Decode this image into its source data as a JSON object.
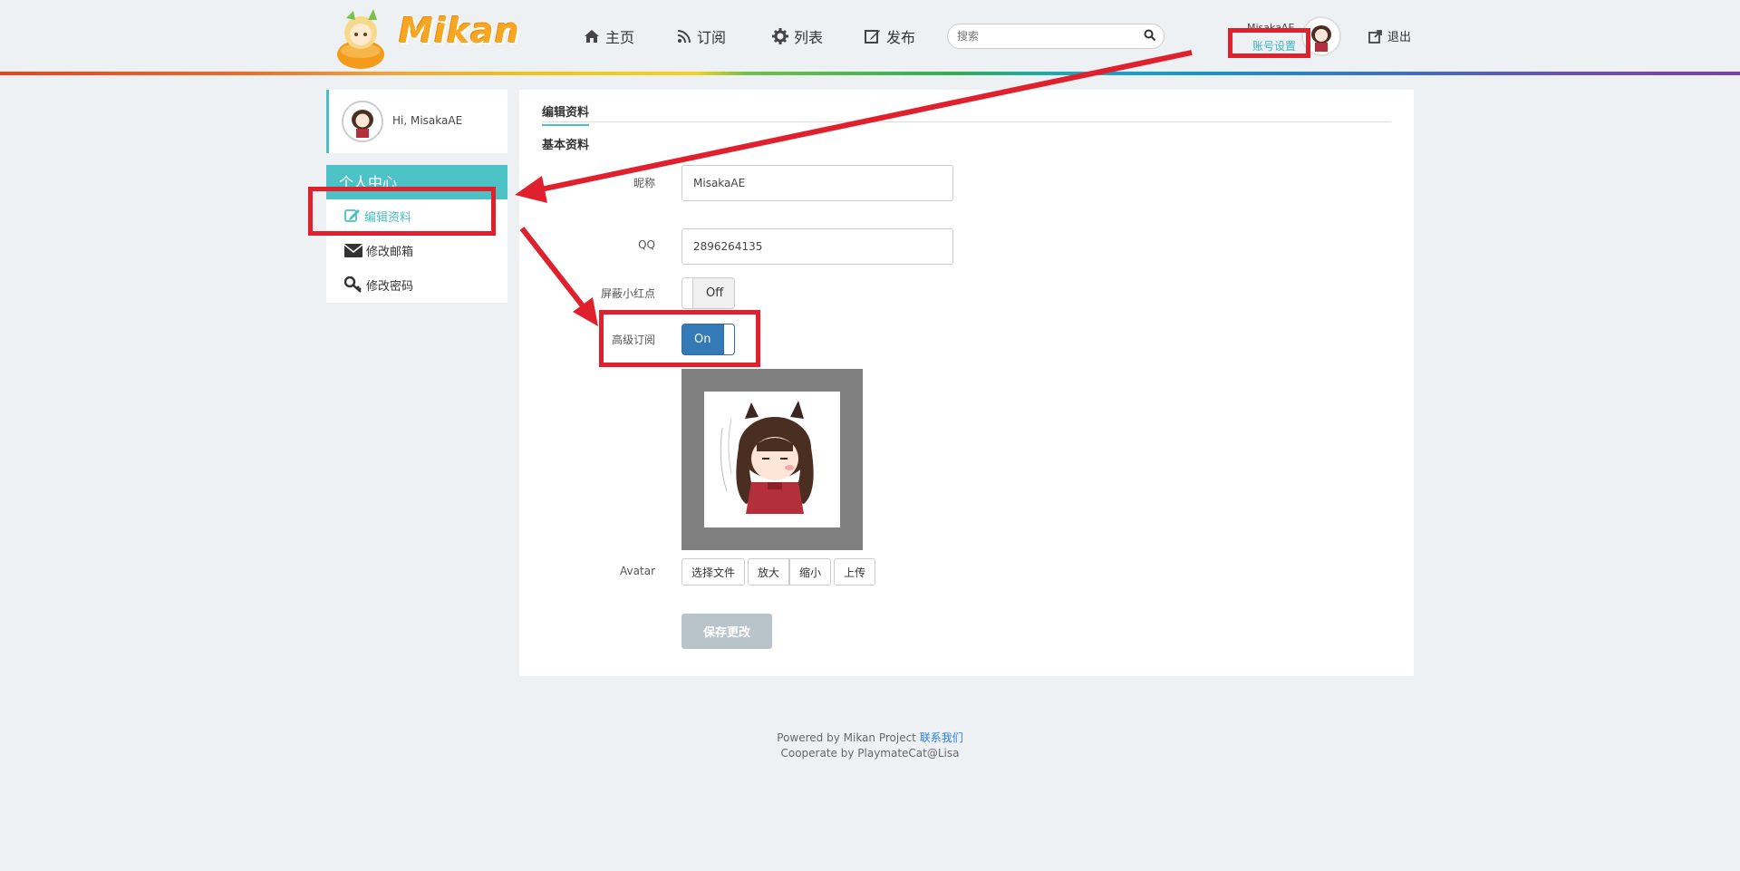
{
  "header": {
    "logo_text": "Mikan",
    "nav": [
      {
        "label": "主页",
        "icon": "home-icon"
      },
      {
        "label": "订阅",
        "icon": "rss-icon"
      },
      {
        "label": "列表",
        "icon": "gear-icon"
      },
      {
        "label": "发布",
        "icon": "edit-icon"
      }
    ],
    "search_placeholder": "搜索",
    "user_name": "MisakaAE",
    "account_settings": "账号设置",
    "logout": "退出"
  },
  "sidebar": {
    "greeting": "Hi, MisakaAE",
    "section_title": "个人中心",
    "items": [
      {
        "label": "编辑资料",
        "icon": "edit-icon",
        "active": true
      },
      {
        "label": "修改邮箱",
        "icon": "envelope-icon",
        "active": false
      },
      {
        "label": "修改密码",
        "icon": "key-icon",
        "active": false
      }
    ]
  },
  "main": {
    "tab": "编辑资料",
    "section": "基本资料",
    "fields": {
      "nickname_label": "昵称",
      "nickname_value": "MisakaAE",
      "qq_label": "QQ",
      "qq_value": "2896264135",
      "hide_dot_label": "屏蔽小红点",
      "hide_dot_state": "Off",
      "advanced_sub_label": "高级订阅",
      "advanced_sub_state": "On",
      "avatar_label": "Avatar"
    },
    "avatar_buttons": {
      "choose": "选择文件",
      "zoom_in": "放大",
      "zoom_out": "缩小",
      "upload": "上传"
    },
    "save": "保存更改"
  },
  "footer": {
    "line1_prefix": "Powered by Mikan Project",
    "contact": "联系我们",
    "line2": "Cooperate by PlaymateCat@Lisa"
  },
  "colors": {
    "accent": "#49c0c3",
    "toggle_on": "#337ab7",
    "annotation": "#e0202c"
  }
}
